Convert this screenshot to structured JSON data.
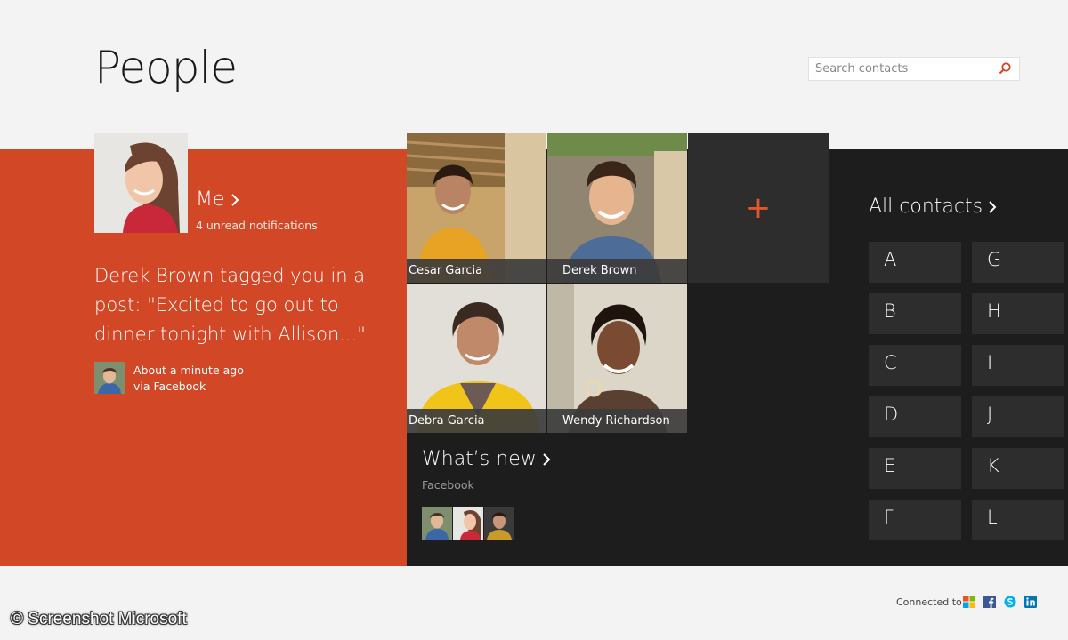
{
  "header": {
    "title": "People",
    "search": {
      "placeholder": "Search contacts"
    }
  },
  "me": {
    "label": "Me",
    "subtitle": "4 unread notifications",
    "notification": {
      "text": "Derek Brown tagged you in a post: \"Excited to go out to dinner tonight with Allison...\"",
      "time": "About a minute ago",
      "source": "via Facebook"
    }
  },
  "favorites": [
    {
      "name": "Cesar Garcia"
    },
    {
      "name": "Derek Brown"
    },
    {
      "name": "Debra Garcia"
    },
    {
      "name": "Wendy Richardson"
    }
  ],
  "add_tile": {
    "icon": "plus-icon",
    "glyph": "+"
  },
  "whats_new": {
    "label": "What’s new",
    "subtitle": "Facebook"
  },
  "all_contacts": {
    "label": "All contacts",
    "letters": [
      "A",
      "G",
      "B",
      "H",
      "C",
      "I",
      "D",
      "J",
      "E",
      "K",
      "F",
      "L"
    ]
  },
  "footer": {
    "connected_label": "Connected to",
    "networks": [
      "windows-icon",
      "facebook-icon",
      "skype-icon",
      "linkedin-icon"
    ]
  },
  "watermark": "© Screenshot Microsoft",
  "colors": {
    "accent": "#d24726",
    "dark_panel": "#1d1d1d",
    "tile": "#2d2d2d",
    "background": "#f3f3f3"
  }
}
